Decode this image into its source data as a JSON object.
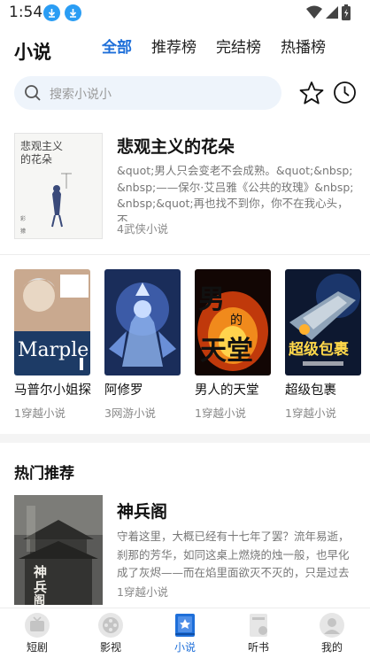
{
  "status_bar": {
    "time": "1:54"
  },
  "header": {
    "title": "小说",
    "tabs": [
      {
        "label": "全部",
        "active": true
      },
      {
        "label": "推荐榜",
        "active": false
      },
      {
        "label": "完结榜",
        "active": false
      },
      {
        "label": "热播榜",
        "active": false
      }
    ]
  },
  "search": {
    "placeholder": "搜索小说小"
  },
  "featured": {
    "title": "悲观主义的花朵",
    "cover_text": "悲观主义的花朵",
    "description": "&quot;男人只会变老不会成熟。&quot;&nbsp;&nbsp;——保尔·艾吕雅《公共的玫瑰》&nbsp;&nbsp;&quot;再也找不到你，你不在我心头，不",
    "meta": "4武侠小说"
  },
  "books": [
    {
      "title": "马普尔小姐探",
      "meta": "1穿越小说",
      "cover_text": "Marple"
    },
    {
      "title": "阿修罗",
      "meta": "3网游小说",
      "cover_text": ""
    },
    {
      "title": "男人的天堂",
      "meta": "1穿越小说",
      "cover_text": "男人的天堂"
    },
    {
      "title": "超级包裹",
      "meta": "1穿越小说",
      "cover_text": "超级包裹"
    }
  ],
  "hot_section": {
    "title": "热门推荐",
    "items": [
      {
        "title": "神兵阁",
        "description": "守着这里，大概已经有十七年了罢？流年易逝，刹那的芳华，如同这桌上燃烧的烛一般，也早化成了灰烬——而在焰里面欲灭不灭的，只是过去",
        "meta": "1穿越小说",
        "cover_text": "神兵阁"
      }
    ]
  },
  "bottom_nav": [
    {
      "label": "短剧",
      "icon": "tv-icon",
      "active": false
    },
    {
      "label": "影视",
      "icon": "film-reel-icon",
      "active": false
    },
    {
      "label": "小说",
      "icon": "book-icon",
      "active": true
    },
    {
      "label": "听书",
      "icon": "audiobook-icon",
      "active": false
    },
    {
      "label": "我的",
      "icon": "profile-icon",
      "active": false
    }
  ],
  "colors": {
    "accent": "#1e6fd9",
    "search_bg": "#eef4fb",
    "download_badge": "#2a9df4"
  }
}
